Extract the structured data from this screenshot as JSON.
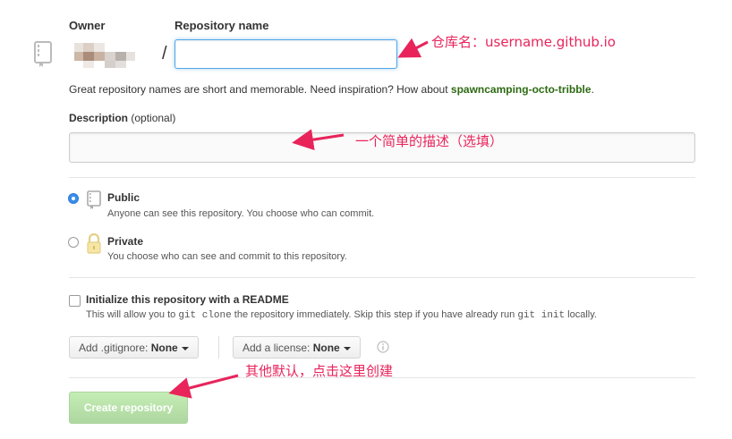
{
  "owner": {
    "label": "Owner"
  },
  "repo_name": {
    "label": "Repository name",
    "value": ""
  },
  "separator": "/",
  "hint": {
    "text": "Great repository names are short and memorable. Need inspiration? How about ",
    "suggestion": "spawncamping-octo-tribble",
    "end": "."
  },
  "description": {
    "label": "Description",
    "optional": "(optional)",
    "value": ""
  },
  "visibility": {
    "public": {
      "label": "Public",
      "desc": "Anyone can see this repository. You choose who can commit.",
      "checked": true
    },
    "private": {
      "label": "Private",
      "desc": "You choose who can see and commit to this repository.",
      "checked": false
    }
  },
  "readme": {
    "label": "Initialize this repository with a README",
    "desc_before": "This will allow you to ",
    "code1": "git clone",
    "desc_mid": " the repository immediately. Skip this step if you have already run ",
    "code2": "git init",
    "desc_end": " locally."
  },
  "gitignore": {
    "prefix": "Add .gitignore:",
    "value": "None"
  },
  "license": {
    "prefix": "Add a license:",
    "value": "None"
  },
  "create_button": "Create repository",
  "annotations": {
    "repo": "仓库名：username.github.io",
    "desc": "一个简单的描述（选填）",
    "create": "其他默认，点击这里创建"
  },
  "colors": {
    "annotation": "#e8245b",
    "suggestion": "#2d6a12",
    "radio_checked": "#3a8ee6",
    "create_button": "#6cc644"
  }
}
